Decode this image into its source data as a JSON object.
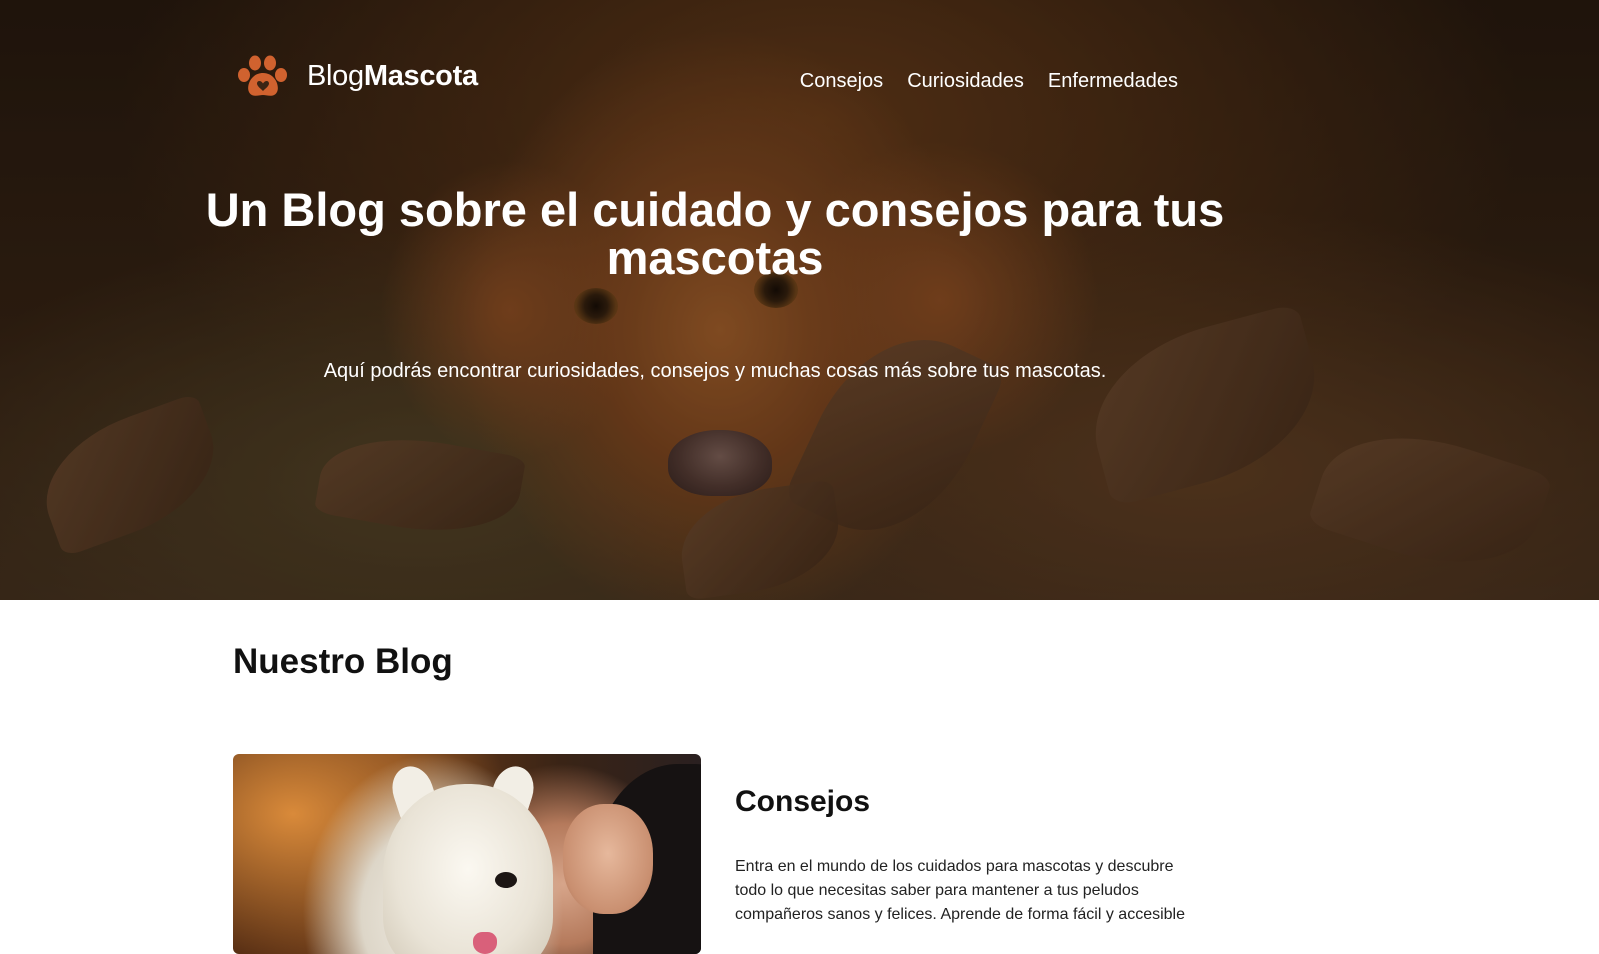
{
  "brand": {
    "name_light": "Blog",
    "name_bold": "Mascota",
    "icon": "paw-icon",
    "accent_color": "#d0622f"
  },
  "nav": {
    "items": [
      {
        "label": "Consejos"
      },
      {
        "label": "Curiosidades"
      },
      {
        "label": "Enfermedades"
      }
    ]
  },
  "hero": {
    "title": "Un Blog sobre el cuidado y consejos para tus mascotas",
    "subtitle": "Aquí podrás encontrar curiosidades, consejos y muchas cosas más sobre tus mascotas.",
    "image": "golden dog lying in autumn leaves"
  },
  "blog": {
    "section_title": "Nuestro Blog",
    "posts": [
      {
        "title": "Consejos",
        "image": "woman hugging white west highland terrier",
        "excerpt": "Entra en el mundo de los cuidados para mascotas y descubre todo lo que necesitas saber para mantener a tus peludos compañeros sanos y felices. Aprende de forma fácil y accesible"
      }
    ]
  }
}
